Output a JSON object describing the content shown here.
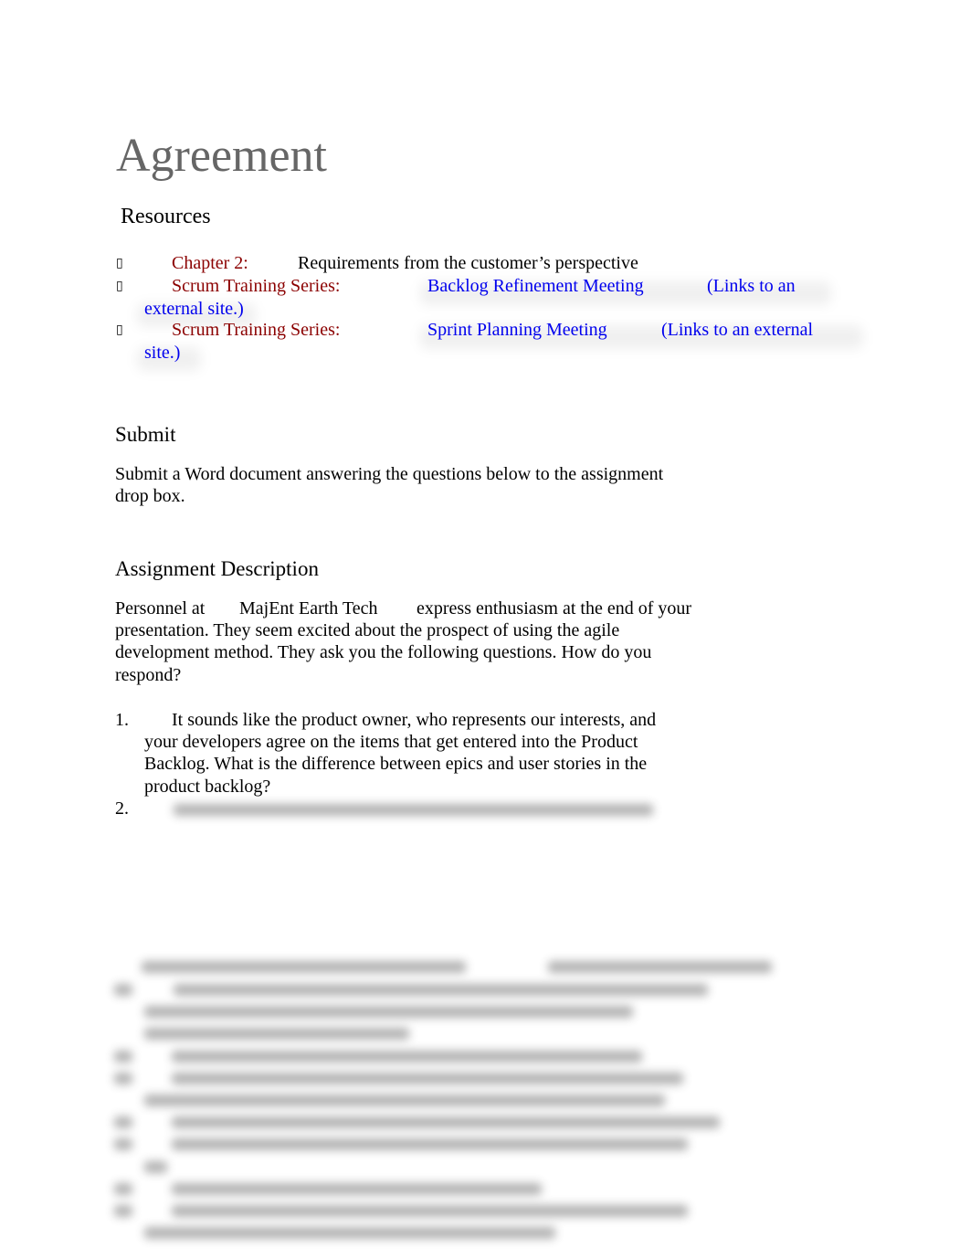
{
  "document": {
    "title": "Agreement",
    "resources": {
      "heading": "Resources",
      "items": [
        {
          "bullet_icon": "bullet-glyph",
          "label": "Chapter 2:",
          "text": "Requirements from the customer’s perspective"
        },
        {
          "bullet_icon": "bullet-glyph",
          "label": "Scrum Training Series:",
          "link": "Backlog Refinement Meeting",
          "note_a": "(Links to an",
          "note_b": "external site.)"
        },
        {
          "bullet_icon": "bullet-glyph",
          "label": "Scrum Training Series:",
          "link": "Sprint Planning Meeting",
          "note_a": "(Links to an external",
          "note_b": "site.)"
        }
      ]
    },
    "submit": {
      "heading": "Submit",
      "lines": [
        "Submit a Word document answering the questions below to the assignment",
        "drop box."
      ]
    },
    "assignment": {
      "heading": "Assignment Description",
      "intro": {
        "prefix": "Personnel at",
        "company": "MajEnt Earth Tech",
        "suffix": "express enthusiasm at the end of your",
        "lines": [
          "presentation. They seem excited about the prospect of using the agile",
          "development method. They ask you the following questions. How do you",
          "respond?"
        ]
      },
      "questions": [
        {
          "number": "1.",
          "lines": [
            "It sounds like the product owner, who represents our interests, and",
            "your developers agree on the items that get entered into the Product",
            "Backlog. What is the difference between epics and user stories in the",
            "product backlog?"
          ]
        },
        {
          "number": "2.",
          "lines": []
        }
      ]
    },
    "hidden_content": "blurred"
  }
}
